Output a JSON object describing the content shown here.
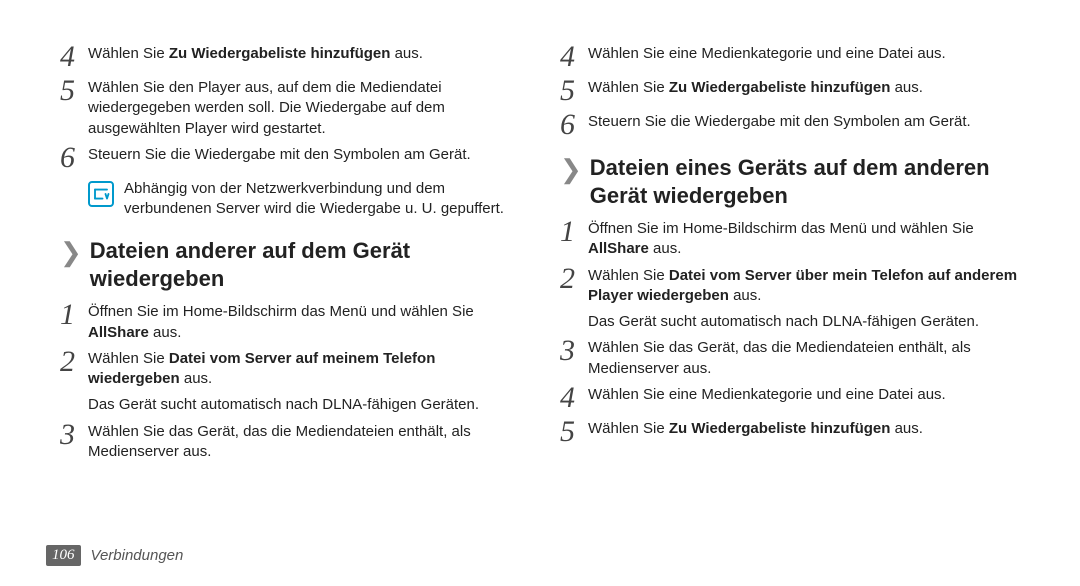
{
  "left": {
    "s4": {
      "pre": "Wählen Sie ",
      "bold": "Zu Wiedergabeliste hinzufügen",
      "post": " aus."
    },
    "s5": "Wählen Sie den Player aus, auf dem die Mediendatei wiedergegeben werden soll. Die Wiedergabe auf dem ausgewählten Player wird gestartet.",
    "s6": "Steuern Sie die Wiedergabe mit den Symbolen am Gerät.",
    "note": "Abhängig von der Netzwerkverbindung und dem verbundenen Server wird die Wiedergabe u. U. gepuffert.",
    "sec1_title": "Dateien anderer auf dem Gerät wiedergeben",
    "sec1": {
      "s1": {
        "pre": "Öffnen Sie im Home-Bildschirm das Menü und wählen Sie ",
        "bold": "AllShare",
        "post": " aus."
      },
      "s2": {
        "pre": "Wählen Sie ",
        "bold": "Datei vom Server auf meinem Telefon wiedergeben",
        "post": " aus."
      },
      "s2sub": "Das Gerät sucht automatisch nach DLNA-fähigen Geräten.",
      "s3": "Wählen Sie das Gerät, das die Mediendateien enthält, als Medienserver aus."
    }
  },
  "right": {
    "s4": "Wählen Sie eine Medienkategorie und eine Datei aus.",
    "s5": {
      "pre": "Wählen Sie ",
      "bold": "Zu Wiedergabeliste hinzufügen",
      "post": " aus."
    },
    "s6": "Steuern Sie die Wiedergabe mit den Symbolen am Gerät.",
    "sec2_title": "Dateien eines Geräts auf dem anderen Gerät wiedergeben",
    "sec2": {
      "s1": {
        "pre": "Öffnen Sie im Home-Bildschirm das Menü und wählen Sie ",
        "bold": "AllShare",
        "post": " aus."
      },
      "s2": {
        "pre": "Wählen Sie ",
        "bold": "Datei vom Server über mein Telefon auf anderem Player wiedergeben",
        "post": " aus."
      },
      "s2sub": "Das Gerät sucht automatisch nach DLNA-fähigen Geräten.",
      "s3": "Wählen Sie das Gerät, das die Mediendateien enthält, als Medienserver aus.",
      "s4": "Wählen Sie eine Medienkategorie und eine Datei aus.",
      "s5": {
        "pre": "Wählen Sie ",
        "bold": "Zu Wiedergabeliste hinzufügen",
        "post": " aus."
      }
    }
  },
  "footer": {
    "page": "106",
    "section": "Verbindungen"
  },
  "nums": {
    "n1": "1",
    "n2": "2",
    "n3": "3",
    "n4": "4",
    "n5": "5",
    "n6": "6"
  },
  "chevron": "❯"
}
